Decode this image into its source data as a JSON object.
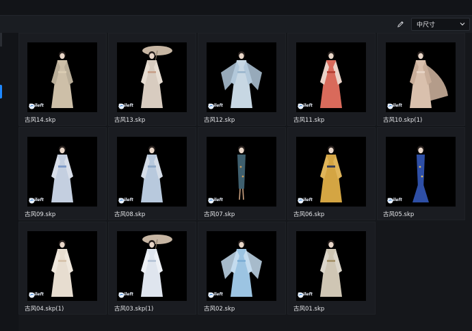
{
  "toolbar": {
    "edit_icon": "pencil-icon",
    "size_select": {
      "value": "中尺寸",
      "icon": "chevron-down-icon"
    }
  },
  "watermark": "Sxileft",
  "files": [
    {
      "name": "古风14.skp",
      "figure": {
        "dress": "#cdbfa8",
        "sleeve": "#b9ad98",
        "accent": "#d9cbb2",
        "prop": ""
      }
    },
    {
      "name": "古风13.skp",
      "figure": {
        "dress": "#d8ccc0",
        "sleeve": "#e7ddd2",
        "accent": "#c9a48e",
        "prop": "umbrella"
      }
    },
    {
      "name": "古风12.skp",
      "figure": {
        "dress": "#c7d7e3",
        "sleeve": "#b2c8da",
        "accent": "#9fb9cf",
        "prop": "wide-sleeves"
      }
    },
    {
      "name": "古风11.skp",
      "figure": {
        "dress": "#d96a5b",
        "sleeve": "#ead1c7",
        "accent": "#b84337",
        "prop": ""
      }
    },
    {
      "name": "古风10.skp(1)",
      "figure": {
        "dress": "#d9c0ad",
        "sleeve": "#c8ad99",
        "accent": "#e6d3c4",
        "prop": "train"
      }
    },
    {
      "name": "古风09.skp",
      "figure": {
        "dress": "#c4cfe0",
        "sleeve": "#d9dfea",
        "accent": "#7f9bc8",
        "prop": ""
      }
    },
    {
      "name": "古风08.skp",
      "figure": {
        "dress": "#b8c9dd",
        "sleeve": "#d5dde8",
        "accent": "#8fa9c7",
        "prop": ""
      }
    },
    {
      "name": "古风07.skp",
      "figure": {
        "dress": "#3e5f6e",
        "sleeve": "#2e4b58",
        "accent": "#c99b5a",
        "prop": "qipao"
      }
    },
    {
      "name": "古风06.skp",
      "figure": {
        "dress": "#d4a543",
        "sleeve": "#e0b55a",
        "accent": "#3a3f55",
        "prop": ""
      }
    },
    {
      "name": "古风05.skp",
      "figure": {
        "dress": "#2e4fa6",
        "sleeve": "#3a5dbd",
        "accent": "#d9b866",
        "prop": "mermaid"
      }
    },
    {
      "name": "古风04.skp(1)",
      "figure": {
        "dress": "#e7ddd0",
        "sleeve": "#efe7dc",
        "accent": "#d7c4ad",
        "prop": ""
      }
    },
    {
      "name": "古风03.skp(1)",
      "figure": {
        "dress": "#dfe5ee",
        "sleeve": "#eef1f6",
        "accent": "#b9c6d8",
        "prop": "umbrella"
      }
    },
    {
      "name": "古风02.skp",
      "figure": {
        "dress": "#9cc4e2",
        "sleeve": "#c4dcef",
        "accent": "#7fb0d6",
        "prop": "wide-sleeves"
      }
    },
    {
      "name": "古风01.skp",
      "figure": {
        "dress": "#cfc6b4",
        "sleeve": "#dcd6ca",
        "accent": "#a8966f",
        "prop": ""
      }
    }
  ]
}
